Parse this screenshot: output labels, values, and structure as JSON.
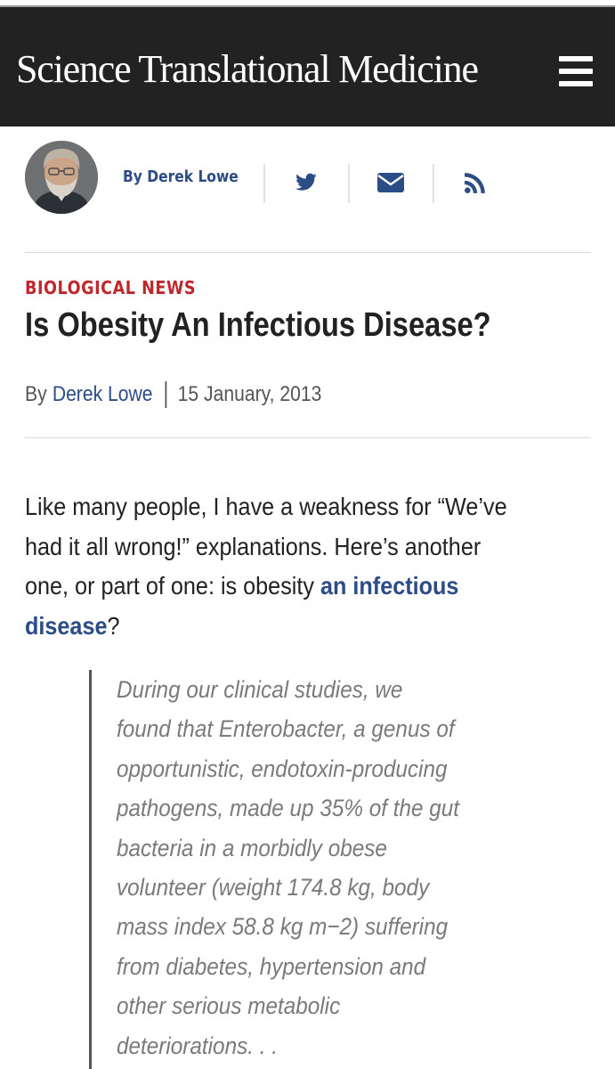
{
  "header": {
    "brand": "Science Translational Medicine",
    "menu_icon": "hamburger-menu-icon",
    "background_color": "#222222"
  },
  "author_bar": {
    "author_label": "By Derek Lowe",
    "share_icons": [
      "twitter-icon",
      "email-icon",
      "rss-icon"
    ],
    "link_color": "#2c4c86"
  },
  "article": {
    "category": "BIOLOGICAL NEWS",
    "category_color": "#c0272d",
    "title": "Is Obesity An Infectious Disease?",
    "byline_prefix": "By",
    "author": "Derek Lowe",
    "date": "15 January, 2013",
    "intro": {
      "line1": "Like many people, I have a weakness for “We’ve",
      "line2": "had it all wrong!” explanations. Here’s another",
      "line3_text": "one, or part of one: is obesity ",
      "link_part1": "an infectious",
      "link_part2": "disease",
      "end": "?"
    },
    "quote_lines": [
      "During our clinical studies, we",
      "found that Enterobacter, a genus of",
      "opportunistic, endotoxin-producing",
      "pathogens, made up 35% of the gut",
      "bacteria in a morbidly obese",
      "volunteer (weight 174.8 kg, body",
      "mass index 58.8 kg m−2) suffering",
      "from diabetes, hypertension and",
      "other serious metabolic",
      "deteriorations. . ."
    ]
  }
}
